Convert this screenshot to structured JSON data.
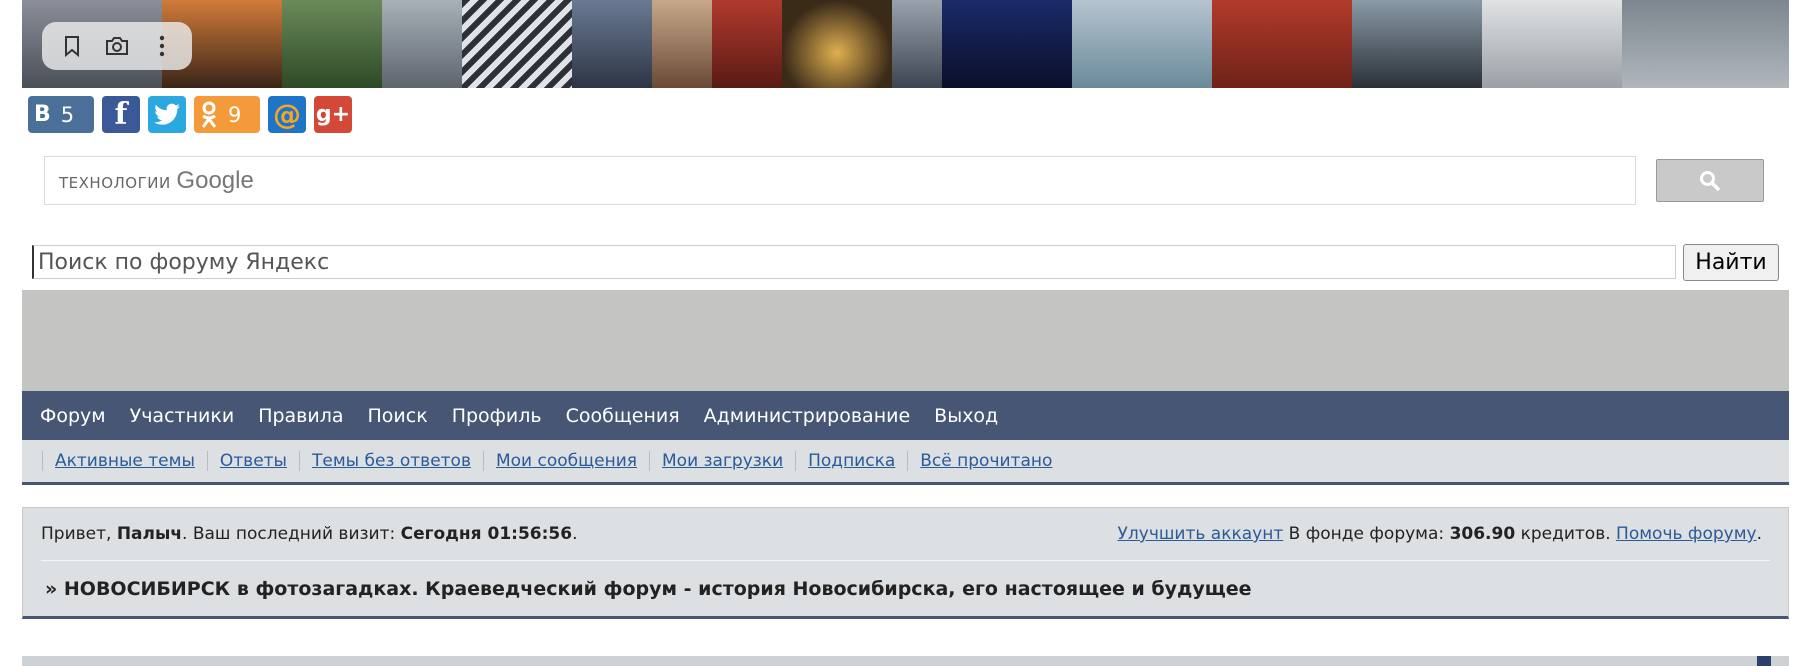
{
  "toolbar": {
    "bookmark_icon": "bookmark-icon",
    "camera_icon": "camera-icon",
    "more_icon": "more-vertical-icon"
  },
  "social": [
    {
      "name": "vkontakte",
      "glyph": "B",
      "count": "5",
      "color": "#4a6f98"
    },
    {
      "name": "facebook",
      "glyph": "f",
      "count": "",
      "color": "#3b5998"
    },
    {
      "name": "twitter",
      "glyph": "t",
      "count": "",
      "color": "#2aa9e0"
    },
    {
      "name": "odnoklassniki",
      "glyph": "ок",
      "count": "9",
      "color": "#f59a3a"
    },
    {
      "name": "mail-ru",
      "glyph": "@",
      "count": "",
      "color": "#1e74c6"
    },
    {
      "name": "google-plus",
      "glyph": "g+",
      "count": "",
      "color": "#d34836"
    }
  ],
  "google_search": {
    "label_prefix": "ТЕХНОЛОГИИ",
    "label_brand": "Google",
    "button_icon": "search-icon"
  },
  "yandex_search": {
    "placeholder": "Поиск по форуму Яндекс",
    "button_label": "Найти"
  },
  "nav": {
    "items": [
      "Форум",
      "Участники",
      "Правила",
      "Поиск",
      "Профиль",
      "Сообщения",
      "Администрирование",
      "Выход"
    ]
  },
  "subnav": {
    "items": [
      "Активные темы",
      "Ответы",
      "Темы без ответов",
      "Мои сообщения",
      "Мои загрузки",
      "Подписка",
      "Всё прочитано"
    ]
  },
  "info": {
    "greet_prefix": "Привет, ",
    "username": "Палыч",
    "visit_label": ".  Ваш последний визит: ",
    "visit_time": "Сегодня 01:56:56",
    "dot": ".",
    "upgrade_link": "Улучшить аккаунт",
    "fund_label": " В фонде форума: ",
    "fund_amount": "306.90",
    "credits_label": " кредитов. ",
    "help_link": "Помочь форуму",
    "forum_title": "» НОВОСИБИРСК в фотозагадках. Краеведческий форум - история Новосибирска, его настоящее и будущее"
  },
  "colors": {
    "nav_bg": "#475675",
    "link": "#2a5a9a",
    "panel_bg": "#dde0e2"
  }
}
